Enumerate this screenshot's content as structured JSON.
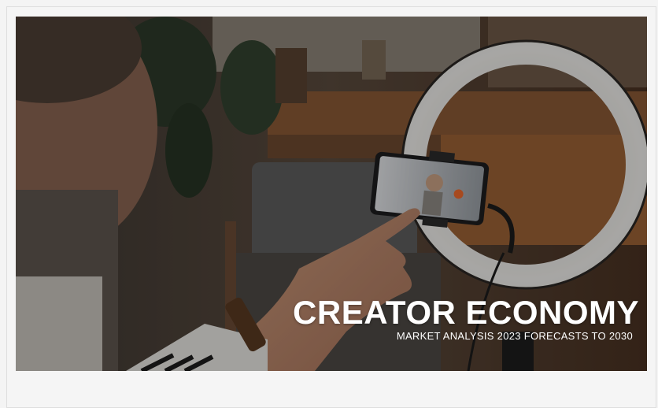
{
  "hero": {
    "title": "CREATOR ECONOMY",
    "subtitle": "MARKET ANALYSIS 2023 FORECASTS TO 2030",
    "image_subject": "ring-light-smartphone-photo"
  },
  "colors": {
    "title_text": "#ffffff",
    "card_background": "#f5f5f5",
    "ring_light": "#e8e4e0",
    "wood_shelf": "#8a5a36"
  }
}
